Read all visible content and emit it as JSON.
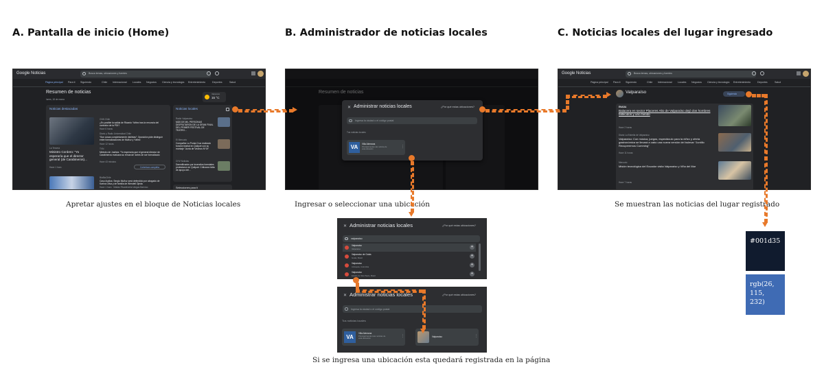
{
  "headings": {
    "a": "A. Pantalla de inicio (Home)",
    "b": "B. Administrador de noticias locales",
    "c": "C. Noticias locales del lugar ingresado"
  },
  "captions": {
    "a": "Apretar ajustes en el bloque de Noticias locales",
    "b": "Ingresar o seleccionar una ubicación",
    "c": "Se muestran las noticias del lugar registrado",
    "bottom": "Si se ingresa una ubicación esta quedará registrada en la página"
  },
  "screen_common": {
    "logo": "Google Noticias",
    "search_placeholder": "Busca temas, ubicaciones y fuentes",
    "nav_tabs": [
      "Página principal",
      "Para ti",
      "Siguiendo",
      "Chile",
      "Internacional",
      "Locales",
      "Negocios",
      "Ciencia y tecnología",
      "Entretenimiento",
      "Deportes",
      "Salud"
    ]
  },
  "screen_a": {
    "summary_title": "Resumen de noticias",
    "summary_date": "lunes, 18 de marzo",
    "weather_city": "Valparaíso",
    "weather_temp": "15 °C",
    "featured_label": "Noticias destacadas",
    "local_label": "Noticias locales",
    "featured_main_source": "La Tercera",
    "featured_main_title": "Ministro Cordero: “Yo esperaría que el director general (de Carabineros)...",
    "featured_main_time": "Hace 1 hora",
    "stories": [
      {
        "source": "CNN Chile",
        "title": "¿Es posible la salida de Ricardo Yáñez tras la renuncia del contralor de la PDI?",
        "time": "Hace 6 horas"
      },
      {
        "source": "Diario y Radio Universidad Chile",
        "title": "“Son cosas completamente distintas”: Oposición pide distinguir entre formalizaciones de Muñoz y Yáñez",
        "time": "Hace 12 horas"
      },
      {
        "source": "TVN",
        "title": "Ministro de Justicia: “Yo esperaría que el general director de Carabineros evaluara su renuncia” antes de ser formalizado",
        "time": "Hace 43 minutos"
      }
    ],
    "full_coverage_button": "Cobertura completa",
    "local_stories": [
      {
        "source": "Radio Valparaíso",
        "title": "MÁS DE MIL PERSONAS DISFRUTARON DE LA GRAN FINAL DEL PRIMER FESTIVAL DE TEATRO..."
      },
      {
        "source": "El Mercurio",
        "title": "Compañía La Punta Cruz realizará función teatral en Quilpué con su montaje “Junta de Vecinos Nº19”"
      },
      {
        "source": "CHV Noticias",
        "title": "Damnificados por incendios forestales protestaron en Quilpué: Criticaron falta de apoyo del..."
      }
    ],
    "bottom_source": "BioBioChile",
    "bottom_title": "Caso Audios: Sergio Muñoz será defendido por abogado de Karina Oliva y de familia de Wendell Ojeda",
    "bottom_meta": "Hace 1 hora · Matías Rivadeneira Vargas Barroso",
    "sources_label": "Selecciones para ti"
  },
  "modal": {
    "title": "Administrar noticias locales",
    "why": "¿Por qué estas ubicaciones?",
    "input_placeholder": "Ingresa la ciudad o el código postal",
    "your_label": "Tus noticias locales",
    "saved_badge": "VA",
    "saved_name": "Villa Alemana",
    "saved_desc": "Principal tienda más noticias de esta ubicación"
  },
  "search_step": {
    "query": "valparaíso",
    "results": [
      {
        "name": "Valparaíso",
        "sub": "Valparaíso"
      },
      {
        "name": "Valparaíso de Goiás",
        "sub": "Goiás, Brasil"
      },
      {
        "name": "Valparaíso",
        "sub": "Antioquia, Colombia"
      },
      {
        "name": "Valparaíso",
        "sub": "Estado de São Paulo, Brasil"
      }
    ]
  },
  "saved_step": {
    "new_location": "Valparaíso"
  },
  "screen_c": {
    "place": "Valparaíso",
    "following": "Siguiendo",
    "articles": [
      {
        "source": "ENADA",
        "title": "Balacera en sector Placeres Alto de Valparaíso dejó dos hombres fallecidos y uno herido",
        "time": "Hace 2 horas"
      },
      {
        "source": "Diario La Estrella de Valparaíso",
        "title": "Valparaíso: Con música, juegos, espectáculo para la niñez y oferta gastronómica se llevará a cabo una nueva versión del bulevar “Juntillo Recuperemos Cumming”",
        "time": "Hace 11 horas"
      },
      {
        "source": "Mercurio",
        "title": "Misión tecnológica del Ecuador visita Valparaíso y Viña del Mar",
        "time": "Hace 7 horas"
      }
    ]
  },
  "swatches": {
    "dark": {
      "label": "#001d35",
      "color": "#101b2e"
    },
    "blue": {
      "label": "rgb(26, 115, 232)",
      "color": "#3f6bb4"
    }
  },
  "accent": "#e8792a"
}
